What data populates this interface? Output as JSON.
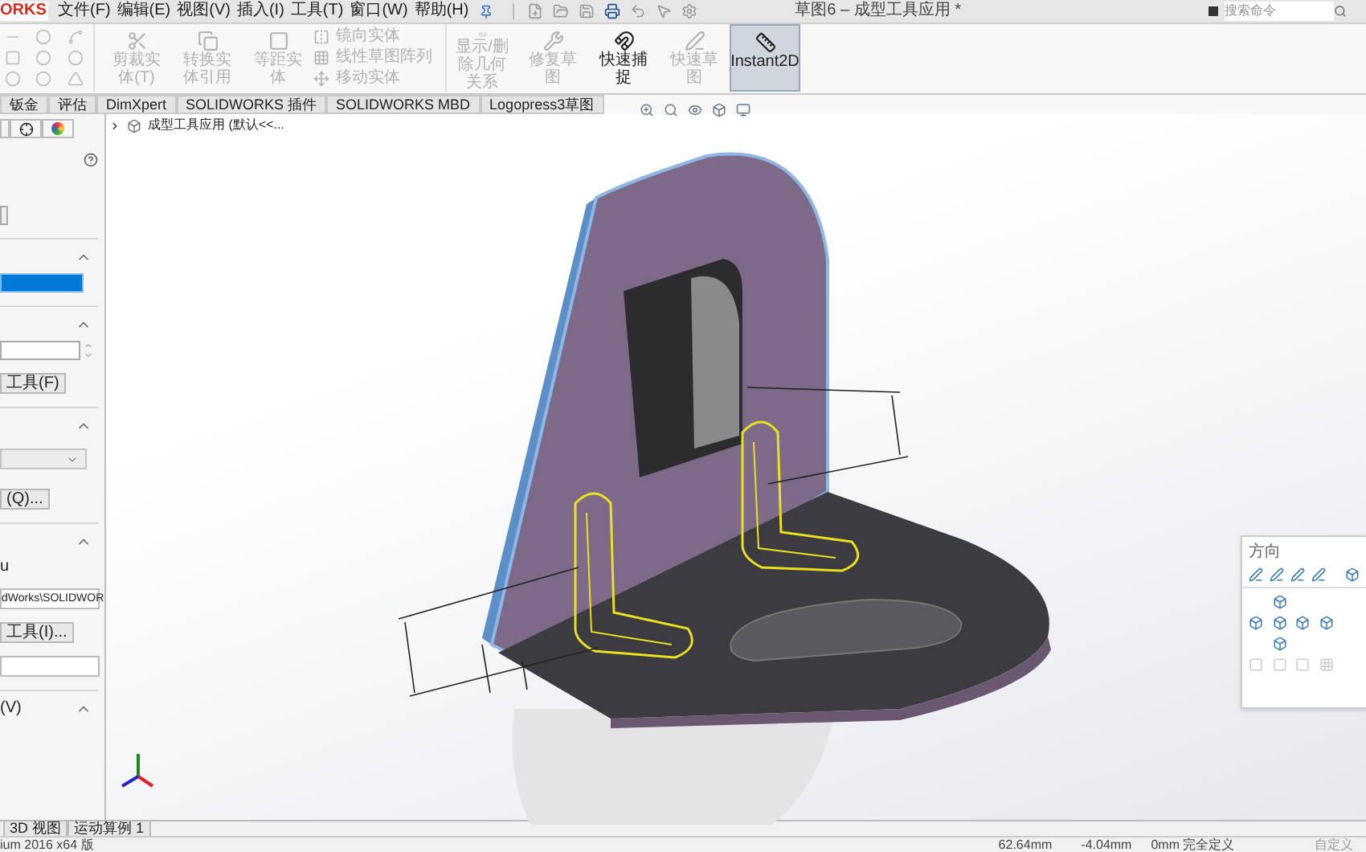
{
  "app": {
    "logo": "ORKS",
    "menus": [
      "文件(F)",
      "编辑(E)",
      "视图(V)",
      "插入(I)",
      "工具(T)",
      "窗口(W)",
      "帮助(H)"
    ],
    "title": "草图6 – 成型工具应用 *",
    "search": {
      "placeholder": "搜索命令"
    }
  },
  "ribbon": [
    {
      "kind": "large",
      "label": "剪裁实体(T)",
      "disabled": true,
      "selected": false
    },
    {
      "kind": "large",
      "label": "转换实体引用",
      "disabled": true,
      "selected": false
    },
    {
      "kind": "large",
      "label": "等距实体",
      "disabled": true,
      "selected": false
    },
    {
      "kind": "small",
      "label": "镜向实体",
      "disabled": true,
      "selected": false
    },
    {
      "kind": "small",
      "label": "线性草图阵列",
      "disabled": true,
      "selected": false
    },
    {
      "kind": "small",
      "label": "移动实体",
      "disabled": true,
      "selected": false
    },
    {
      "kind": "large",
      "label": "显示/删除几何关系",
      "disabled": true,
      "selected": false
    },
    {
      "kind": "large",
      "label": "修复草图",
      "disabled": true,
      "selected": false
    },
    {
      "kind": "large",
      "label": "快速捕捉",
      "disabled": false,
      "selected": false
    },
    {
      "kind": "large",
      "label": "快速草图",
      "disabled": true,
      "selected": false
    },
    {
      "kind": "large",
      "label": "Instant2D",
      "disabled": false,
      "selected": true
    }
  ],
  "command_tabs": [
    {
      "label": "钣金",
      "selected": false
    },
    {
      "label": "评估",
      "selected": false
    },
    {
      "label": "DimXpert",
      "selected": false
    },
    {
      "label": "SOLIDWORKS 插件",
      "selected": false
    },
    {
      "label": "SOLIDWORKS MBD",
      "selected": false
    },
    {
      "label": "Logopress3草图",
      "selected": false
    }
  ],
  "panel": {
    "items": [
      {
        "kind": "section"
      },
      {
        "kind": "selection"
      },
      {
        "kind": "section"
      },
      {
        "kind": "spin"
      },
      {
        "kind": "button",
        "label": "工具(F)"
      },
      {
        "kind": "section"
      },
      {
        "kind": "select"
      },
      {
        "kind": "button",
        "label": "(Q)..."
      },
      {
        "kind": "section"
      },
      {
        "kind": "label",
        "label": "u"
      },
      {
        "kind": "field",
        "value": "dWorks\\SOLIDWOR"
      },
      {
        "kind": "button",
        "label": "工具(I)..."
      },
      {
        "kind": "field"
      },
      {
        "kind": "section",
        "label": "(V)"
      }
    ]
  },
  "tree": {
    "label": "成型工具应用 (默认<<..."
  },
  "orientation": {
    "title": "方向"
  },
  "bottom_tabs": [
    {
      "label": "3D 视图",
      "selected": false
    },
    {
      "label": "运动算例 1",
      "selected": false
    }
  ],
  "status": {
    "version": "ium 2016 x64 版",
    "x": "62.64mm",
    "y": "-4.04mm",
    "z": "0mm",
    "state": "完全定义",
    "units": "自定义"
  }
}
